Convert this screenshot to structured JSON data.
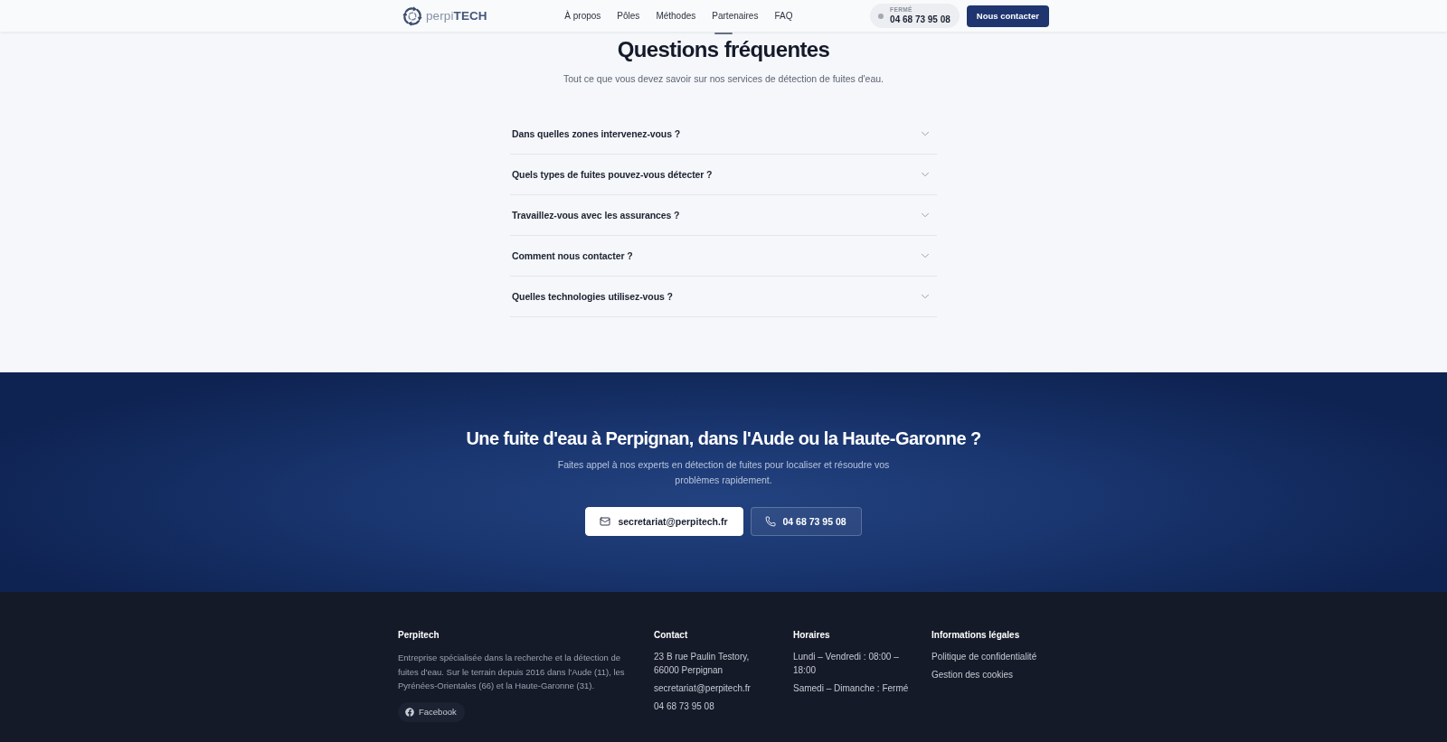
{
  "header": {
    "logo": "perpi**TECH**",
    "nav": [
      "À propos",
      "Pôles",
      "Méthodes",
      "Partenaires",
      "FAQ"
    ],
    "status": {
      "label": "FERMÉ",
      "phone": "04 68 73 95 08",
      "open": false
    },
    "contact_button": "Nous contacter"
  },
  "faq": {
    "title": "Questions fréquentes",
    "subtitle": "Tout ce que vous devez savoir sur nos services de détection de fuites d'eau.",
    "items": [
      {
        "question": "Dans quelles zones intervenez-vous ?",
        "expanded": false
      },
      {
        "question": "Quels types de fuites pouvez-vous détecter ?",
        "expanded": false
      },
      {
        "question": "Travaillez-vous avec les assurances ?",
        "expanded": false
      },
      {
        "question": "Comment nous contacter ?",
        "expanded": false
      },
      {
        "question": "Quelles technologies utilisez-vous ?",
        "expanded": false
      }
    ]
  },
  "contact_banner": {
    "title": "Une fuite d'eau à Perpignan, dans l'Aude ou la Haute-Garonne ?",
    "text": "Faites appel à nos experts en détection de fuites pour localiser et résoudre vos problèmes rapidement.",
    "buttons": [
      {
        "kind": "email",
        "label": "secretariat@perpitech.fr"
      },
      {
        "kind": "phone",
        "label": "04 68 73 95 08"
      }
    ]
  },
  "footer": {
    "about": {
      "heading": "Perpitech",
      "text": "Entreprise spécialisée dans la recherche et la détection de fuites d'eau. Sur le terrain depuis 2016 dans l'Aude (11), les Pyrénées-Orientales (66) et la Haute-Garonne (31).",
      "social_link": "Facebook"
    },
    "contact": {
      "heading": "Contact",
      "address": "23 B rue Paulin Testory, 66000 Perpignan",
      "email": "secretariat@perpitech.fr",
      "phone": "04 68 73 95 08"
    },
    "hours": {
      "heading": "Horaires",
      "lines": [
        "Lundi – Vendredi : 08:00 – 18:00",
        "Samedi – Dimanche : Fermé"
      ]
    },
    "legal": {
      "heading": "Informations légales",
      "links": [
        "Politique de confidentialité",
        "Gestion des cookies"
      ]
    }
  }
}
